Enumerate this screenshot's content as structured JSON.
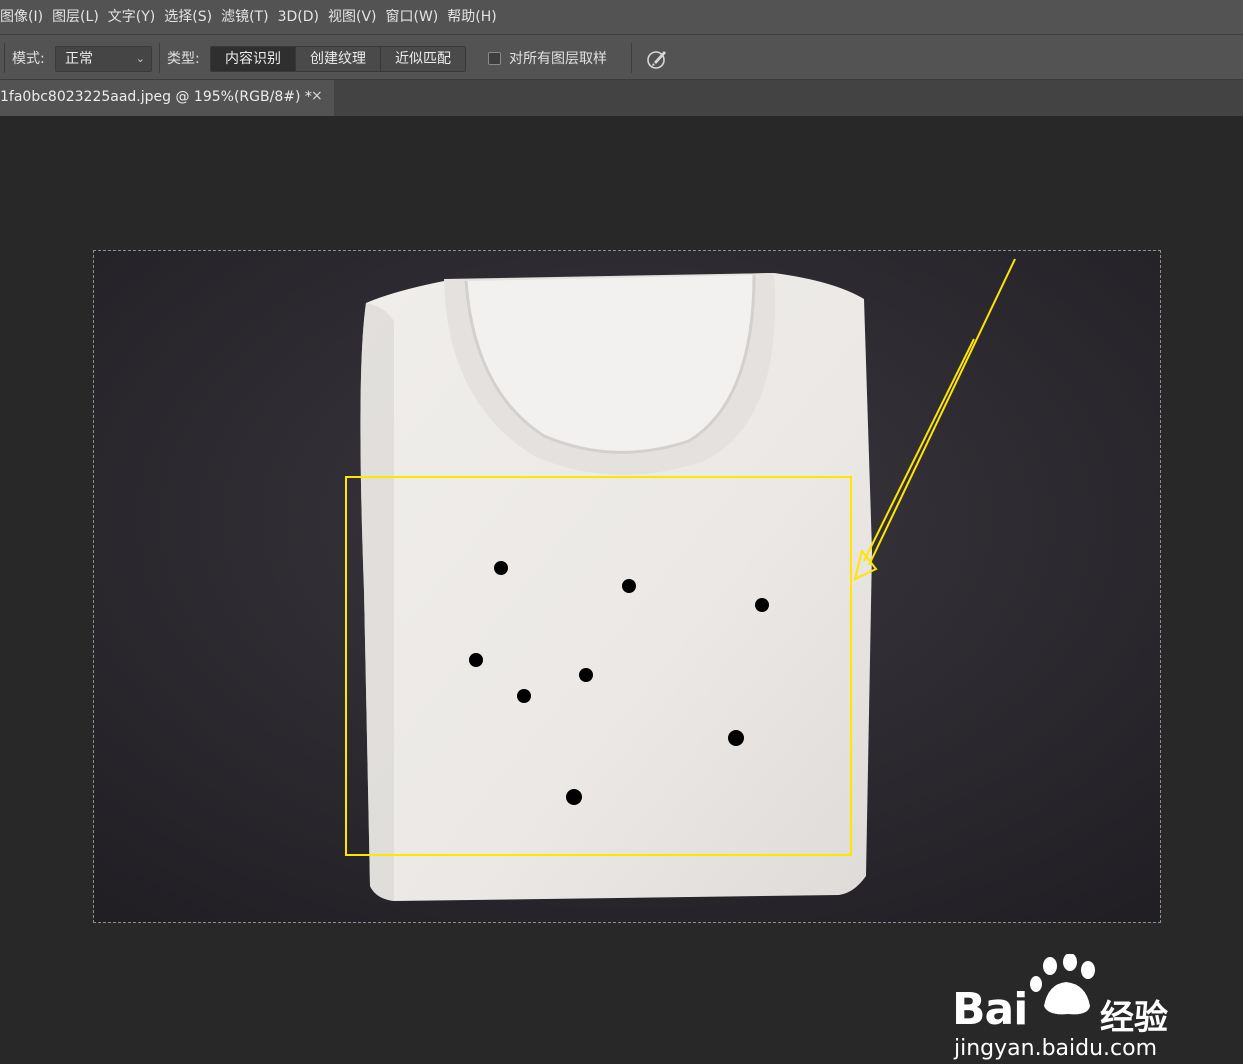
{
  "menu": {
    "items": [
      "图像(I)",
      "图层(L)",
      "文字(Y)",
      "选择(S)",
      "滤镜(T)",
      "3D(D)",
      "视图(V)",
      "窗口(W)",
      "帮助(H)"
    ]
  },
  "options": {
    "mode_label": "模式:",
    "mode_value": "正常",
    "type_label": "类型:",
    "type_buttons": [
      "内容识别",
      "创建纹理",
      "近似匹配"
    ],
    "sample_all_layers_label": "对所有图层取样"
  },
  "document": {
    "tab_title": "1fa0bc8023225aad.jpeg @ 195%(RGB/8#) *",
    "close_glyph": "×"
  },
  "annotations": {
    "highlight_color": "#ffe600",
    "dot_color": "#000000"
  },
  "watermark": {
    "brand_left": "Bai",
    "brand_right": "经验",
    "url": "jingyan.baidu.com"
  },
  "colors": {
    "panel": "#535353",
    "canvas": "#282828",
    "backdrop": "#2b2a2f",
    "shirt": "#ece9e6"
  }
}
